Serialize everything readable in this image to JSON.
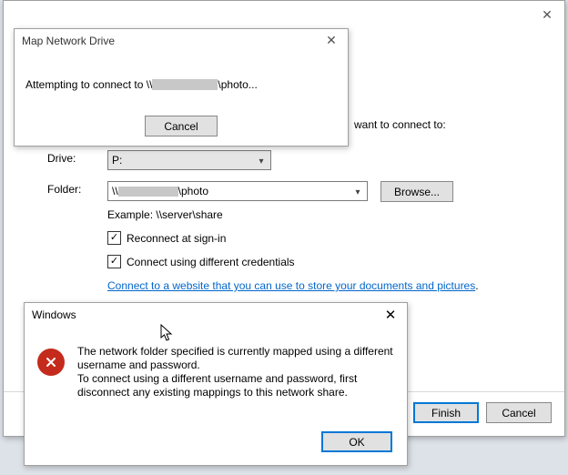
{
  "main": {
    "prompt_tail": "want to connect to:",
    "drive_label": "Drive:",
    "drive_value": "P:",
    "folder_label": "Folder:",
    "folder_prefix": "\\\\",
    "folder_suffix": "\\photo",
    "browse": "Browse...",
    "example": "Example: \\\\server\\share",
    "chk_reconnect": "Reconnect at sign-in",
    "chk_creds": "Connect using different credentials",
    "link_text": "Connect to a website that you can use to store your documents and pictures",
    "finish": "Finish",
    "cancel": "Cancel"
  },
  "conn": {
    "title": "Map Network Drive",
    "msg_prefix": "Attempting to connect to \\\\",
    "msg_suffix": "\\photo...",
    "cancel": "Cancel"
  },
  "err": {
    "title": "Windows",
    "line1": "The network folder specified is currently mapped using a different username and password.",
    "line2": "To connect using a different username and password, first disconnect any existing mappings to this network share.",
    "ok": "OK"
  }
}
